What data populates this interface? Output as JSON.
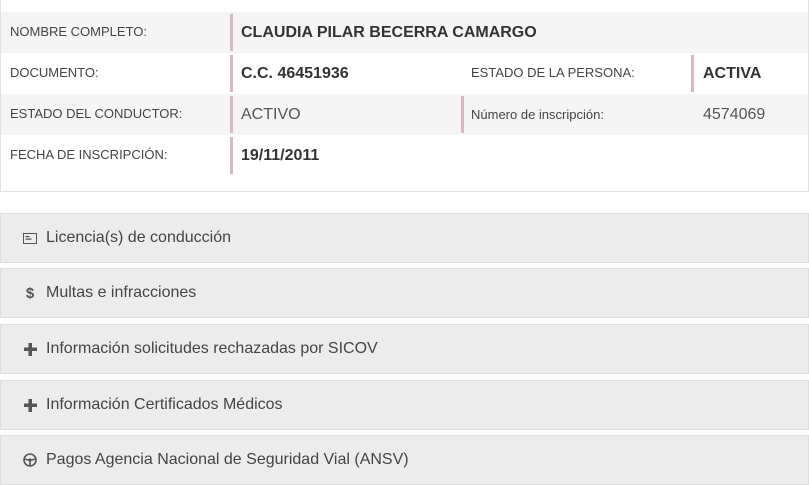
{
  "person": {
    "nombre_label": "NOMBRE COMPLETO:",
    "nombre_value": "CLAUDIA PILAR BECERRA CAMARGO",
    "documento_label": "DOCUMENTO:",
    "documento_value": "C.C. 46451936",
    "estado_persona_label": "ESTADO DE LA PERSONA:",
    "estado_persona_value": "ACTIVA",
    "estado_conductor_label": "ESTADO DEL CONDUCTOR:",
    "estado_conductor_value": "ACTIVO",
    "numero_inscripcion_label": "Número de inscripción:",
    "numero_inscripcion_value": "4574069",
    "fecha_inscripcion_label": "FECHA DE INSCRIPCIÓN:",
    "fecha_inscripcion_value": "19/11/2011"
  },
  "sections": [
    {
      "icon": "id-card-icon",
      "label": "Licencia(s) de conducción"
    },
    {
      "icon": "dollar-icon",
      "label": "Multas e infracciones"
    },
    {
      "icon": "plus-icon",
      "label": "Información solicitudes rechazadas por SICOV"
    },
    {
      "icon": "plus-icon",
      "label": "Información Certificados Médicos"
    },
    {
      "icon": "steering-wheel-icon",
      "label": "Pagos Agencia Nacional de Seguridad Vial (ANSV)"
    }
  ],
  "colors": {
    "accent_bar": "#d9b9bf",
    "row_shade": "#f5f5f5",
    "accordion_bg": "#ececec"
  }
}
